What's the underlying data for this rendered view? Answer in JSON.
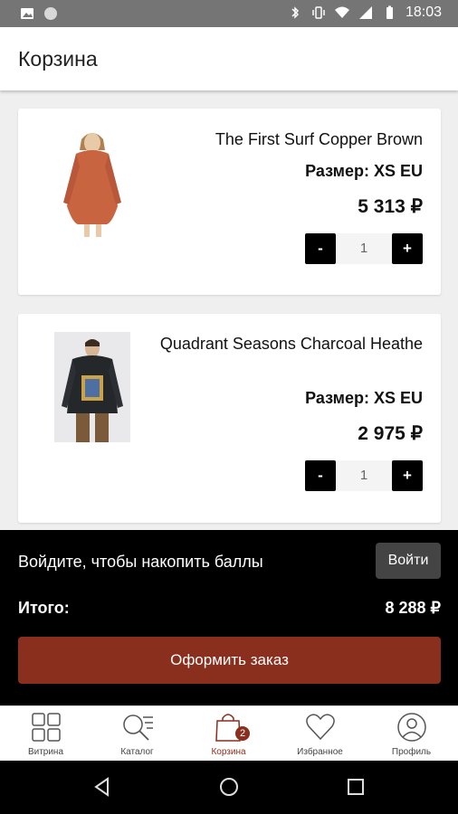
{
  "status": {
    "time": "18:03"
  },
  "header": {
    "title": "Корзина"
  },
  "items": [
    {
      "name": "The First Surf Copper Brown",
      "size": "Размер: XS EU",
      "price": "5 313 ₽",
      "qty": "1",
      "minus": "-",
      "plus": "+"
    },
    {
      "name": "Quadrant Seasons Charcoal Heathe",
      "size": "Размер: XS EU",
      "price": "2 975 ₽",
      "qty": "1",
      "minus": "-",
      "plus": "+"
    }
  ],
  "footer": {
    "promo": "Войдите, чтобы накопить баллы",
    "login_label": "Войти",
    "total_label": "Итого:",
    "total_value": "8 288 ₽",
    "order_label": "Оформить заказ"
  },
  "tabs": [
    {
      "label": "Витрина",
      "icon": "grid-icon"
    },
    {
      "label": "Каталог",
      "icon": "search-list-icon"
    },
    {
      "label": "Корзина",
      "icon": "shopping-bag-icon",
      "badge": "2",
      "active": true
    },
    {
      "label": "Избранное",
      "icon": "heart-icon"
    },
    {
      "label": "Профиль",
      "icon": "profile-icon"
    }
  ],
  "colors": {
    "accent": "#8a2e1e",
    "status_bar": "#757575",
    "footer": "#000000"
  }
}
